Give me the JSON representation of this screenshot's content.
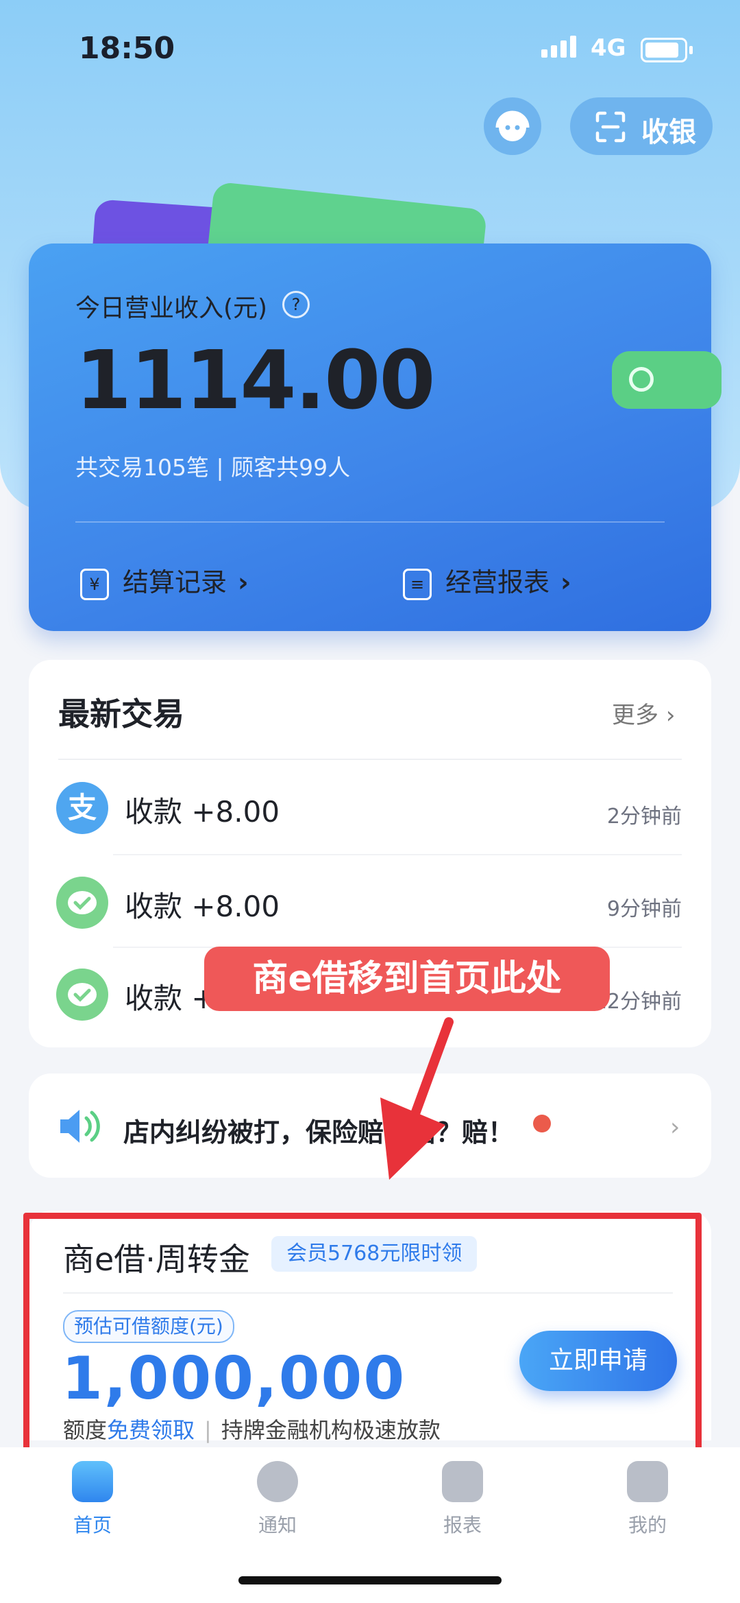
{
  "status_bar": {
    "time": "18:50",
    "network": "4G"
  },
  "header": {
    "cashier_label": "收银"
  },
  "income_card": {
    "label": "今日营业收入(元)",
    "help": "?",
    "amount": "1114.00",
    "summary": "共交易105笔 | 顾客共99人",
    "settlement_link": "结算记录",
    "report_link": "经营报表",
    "settlement_icon": "¥"
  },
  "transactions": {
    "title": "最新交易",
    "more": "更多",
    "items": [
      {
        "label": "收款 +8.00",
        "time": "2分钟前",
        "icon": "alipay-icon"
      },
      {
        "label": "收款 +8.00",
        "time": "9分钟前",
        "icon": "wechat-pay-icon"
      },
      {
        "label": "收款 +8.00",
        "time": "12分钟前",
        "icon": "wechat-pay-icon"
      }
    ]
  },
  "notice": {
    "text": "店内纠纷被打，保险赔不赔？赔！"
  },
  "loan": {
    "title": "商e借·周转金",
    "badge": "会员5768元限时领",
    "sub_label": "预估可借额度(元)",
    "amount": "1,000,000",
    "note_prefix": "额度",
    "note_free": "免费领取",
    "note_sep": "|",
    "note_suffix": "持牌金融机构极速放款",
    "apply_button": "立即申请"
  },
  "annotation": {
    "text": "商e借移到首页此处"
  },
  "tabbar": {
    "items": [
      {
        "label": "首页",
        "active": true
      },
      {
        "label": "通知",
        "active": false
      },
      {
        "label": "报表",
        "active": false
      },
      {
        "label": "我的",
        "active": false
      }
    ]
  },
  "colors": {
    "primary": "#3f86ea",
    "annotation_red": "#e8323a",
    "wallet_green": "#5bcf85"
  }
}
